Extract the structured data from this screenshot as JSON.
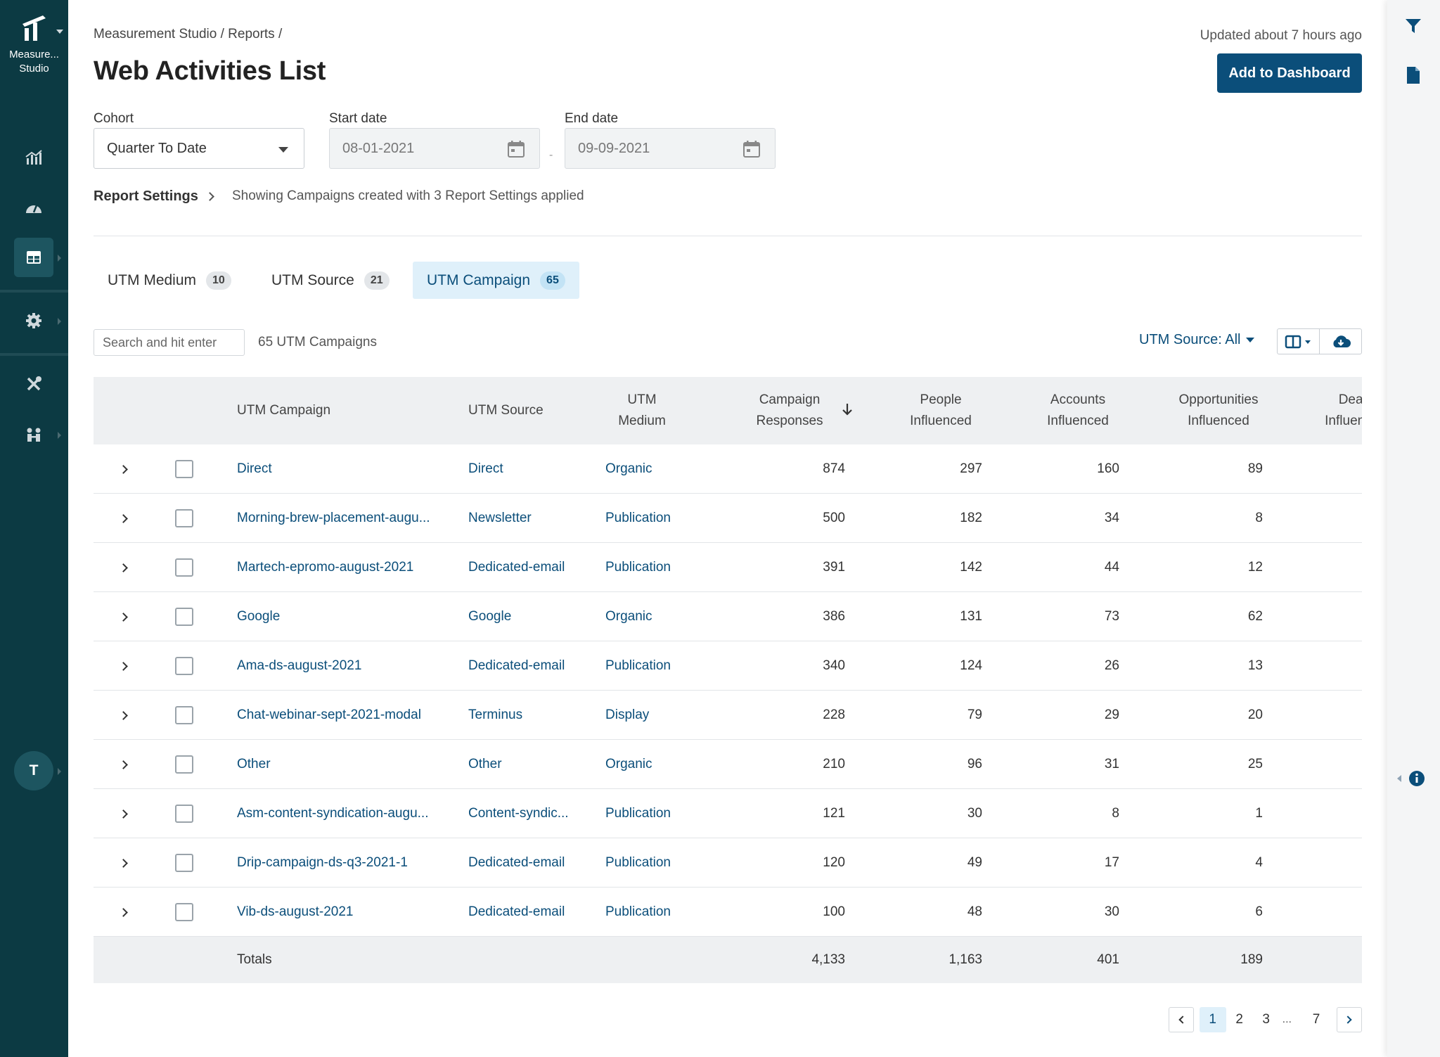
{
  "app": {
    "name": "Measure... Studio",
    "name_line1": "Measure...",
    "name_line2": "Studio",
    "user_initial": "T"
  },
  "colors": {
    "nav_bg": "#0c3a43",
    "primary": "#0b4e7a",
    "active_tab_bg": "#dff0fa",
    "header_bg": "#eef0f2"
  },
  "breadcrumb": "Measurement Studio / Reports /",
  "updated": "Updated about 7 hours ago",
  "title": "Web Activities List",
  "add_to_dashboard": "Add to Dashboard",
  "filters": {
    "cohort_label": "Cohort",
    "cohort_value": "Quarter To Date",
    "start_label": "Start date",
    "start_value": "08-01-2021",
    "end_label": "End date",
    "end_value": "09-09-2021",
    "dash": "-"
  },
  "report_settings": {
    "label": "Report Settings",
    "note": "Showing Campaigns created with 3 Report Settings applied"
  },
  "tabs": [
    {
      "label": "UTM Medium",
      "count": "10"
    },
    {
      "label": "UTM Source",
      "count": "21"
    },
    {
      "label": "UTM Campaign",
      "count": "65",
      "active": true
    }
  ],
  "toolbar": {
    "search_placeholder": "Search and hit enter",
    "count_text": "65 UTM Campaigns",
    "utm_filter": "UTM Source: All"
  },
  "table": {
    "headers": {
      "campaign": "UTM Campaign",
      "source": "UTM Source",
      "medium_l1": "UTM",
      "medium_l2": "Medium",
      "responses_l1": "Campaign",
      "responses_l2": "Responses",
      "people_l1": "People",
      "people_l2": "Influenced",
      "accounts_l1": "Accounts",
      "accounts_l2": "Influenced",
      "opps_l1": "Opportunities",
      "opps_l2": "Influenced",
      "deals_l1": "Deals",
      "deals_l2": "Influenced"
    },
    "rows": [
      {
        "campaign": "Direct",
        "source": "Direct",
        "medium": "Organic",
        "responses": "874",
        "people": "297",
        "accounts": "160",
        "opps": "89"
      },
      {
        "campaign": "Morning-brew-placement-augu...",
        "source": "Newsletter",
        "medium": "Publication",
        "responses": "500",
        "people": "182",
        "accounts": "34",
        "opps": "8"
      },
      {
        "campaign": "Martech-epromo-august-2021",
        "source": "Dedicated-email",
        "medium": "Publication",
        "responses": "391",
        "people": "142",
        "accounts": "44",
        "opps": "12"
      },
      {
        "campaign": "Google",
        "source": "Google",
        "medium": "Organic",
        "responses": "386",
        "people": "131",
        "accounts": "73",
        "opps": "62"
      },
      {
        "campaign": "Ama-ds-august-2021",
        "source": "Dedicated-email",
        "medium": "Publication",
        "responses": "340",
        "people": "124",
        "accounts": "26",
        "opps": "13"
      },
      {
        "campaign": "Chat-webinar-sept-2021-modal",
        "source": "Terminus",
        "medium": "Display",
        "responses": "228",
        "people": "79",
        "accounts": "29",
        "opps": "20"
      },
      {
        "campaign": "Other",
        "source": "Other",
        "medium": "Organic",
        "responses": "210",
        "people": "96",
        "accounts": "31",
        "opps": "25"
      },
      {
        "campaign": "Asm-content-syndication-augu...",
        "source": "Content-syndic...",
        "medium": "Publication",
        "responses": "121",
        "people": "30",
        "accounts": "8",
        "opps": "1"
      },
      {
        "campaign": "Drip-campaign-ds-q3-2021-1",
        "source": "Dedicated-email",
        "medium": "Publication",
        "responses": "120",
        "people": "49",
        "accounts": "17",
        "opps": "4"
      },
      {
        "campaign": "Vib-ds-august-2021",
        "source": "Dedicated-email",
        "medium": "Publication",
        "responses": "100",
        "people": "48",
        "accounts": "30",
        "opps": "6"
      }
    ],
    "totals": {
      "label": "Totals",
      "responses": "4,133",
      "people": "1,163",
      "accounts": "401",
      "opps": "189"
    }
  },
  "pagination": {
    "pages": [
      "1",
      "2",
      "3",
      "7"
    ],
    "ellipsis": "...",
    "current": "1"
  }
}
